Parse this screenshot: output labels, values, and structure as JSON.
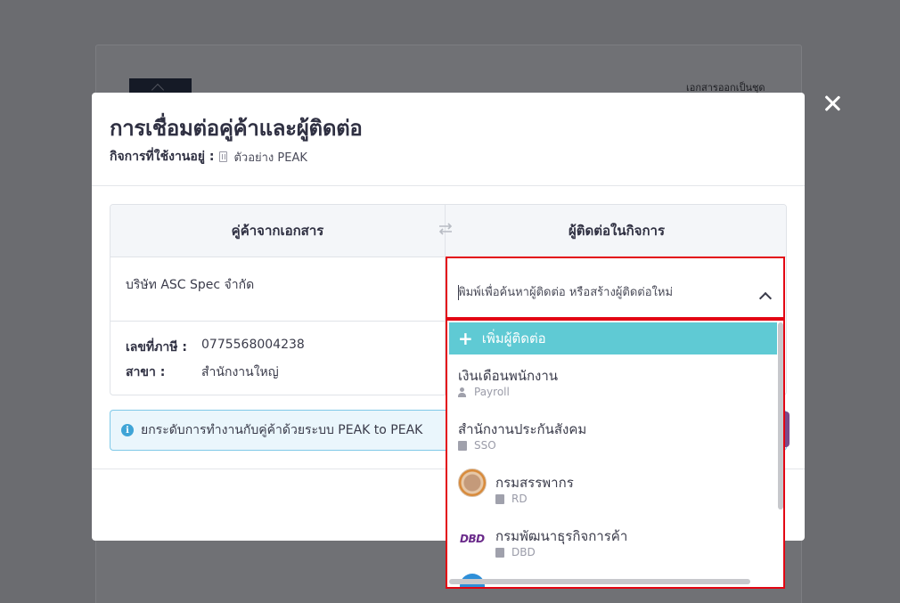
{
  "background": {
    "corner_text": "เอกสารออกเป็นชุด"
  },
  "modal": {
    "title": "การเชื่อมต่อคู่ค้าและผู้ติดต่อ",
    "subtitle_label": "กิจการที่ใช้งานอยู่ :",
    "business_name": "ตัวอย่าง PEAK",
    "left_header": "คู่ค้าจากเอกสาร",
    "right_header": "ผู้ติดต่อในกิจการ",
    "company_name": "บริษัท ASC Spec จำกัด",
    "tax_label": "เลขที่ภาษี :",
    "tax_value": "0775568004238",
    "branch_label": "สาขา :",
    "branch_value": "สำนักงานใหญ่",
    "notice": "ยกระดับการทำงานกับคู่ค้าด้วยระบบ PEAK to PEAK"
  },
  "search": {
    "placeholder": "พิมพ์เพื่อค้นหาผู้ติดต่อ หรือสร้างผู้ติดต่อใหม่"
  },
  "dropdown": {
    "add_label": "เพิ่มผู้ติดต่อ",
    "options": [
      {
        "name": "เงินเดือนพนักงาน",
        "code": "Payroll",
        "icon": "person-icon"
      },
      {
        "name": "สำนักงานประกันสังคม",
        "code": "SSO",
        "icon": "building-icon"
      },
      {
        "name": "กรมสรรพากร",
        "code": "RD",
        "icon": "building-icon",
        "logo": "rd-logo"
      },
      {
        "name": "กรมพัฒนาธุรกิจการค้า",
        "code": "DBD",
        "icon": "building-icon",
        "logo_text": "DBD"
      }
    ]
  },
  "colors": {
    "highlight": "#e30613",
    "add_row": "#5fcad4",
    "notice_border": "#7fc9e8"
  }
}
